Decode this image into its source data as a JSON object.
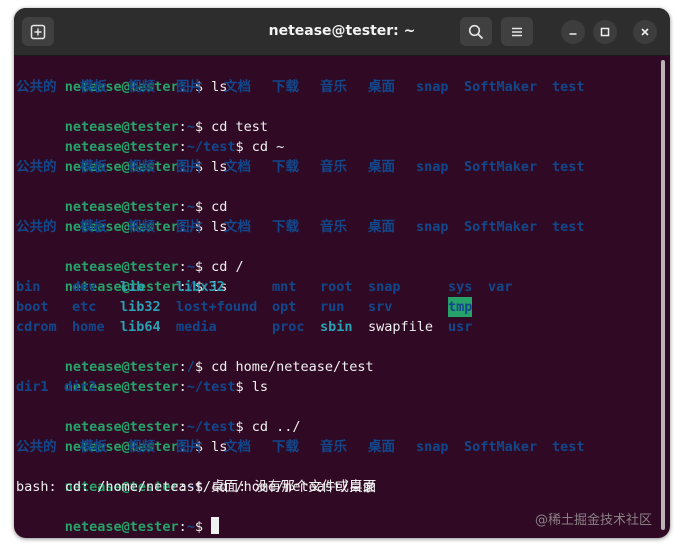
{
  "window": {
    "title": "netease@tester: ~"
  },
  "icons": {
    "new_tab": "new-tab-icon",
    "search": "search-icon",
    "menu": "hamburger-menu-icon",
    "minimize": "minimize-icon",
    "maximize": "maximize-icon",
    "close": "close-icon"
  },
  "colors": {
    "background": "#300a24",
    "user_host": "#26a269",
    "path_and_dirs": "#12488b",
    "text": "#f0f0f0",
    "symlink": "#2aa1b3",
    "sticky_dir_bg": "#26a269"
  },
  "terminal": {
    "user": "netease@tester",
    "home_dirs": [
      "公共的",
      "模板",
      "视频",
      "图片",
      "文档",
      "下载",
      "音乐",
      "桌面",
      "snap",
      "SoftMaker",
      "test"
    ],
    "root_dirs": {
      "row1": [
        "bin",
        "dev",
        "lib",
        "libx32",
        "mnt",
        "root",
        "snap",
        "sys",
        "var"
      ],
      "row2": [
        "boot",
        "etc",
        "lib32",
        "lost+found",
        "opt",
        "run",
        "srv",
        "tmp"
      ],
      "row3": [
        "cdrom",
        "home",
        "lib64",
        "media",
        "proc",
        "sbin",
        "swapfile",
        "usr"
      ]
    },
    "test_dirs": [
      "dir1",
      "dir2"
    ],
    "error_line": "bash: cd: /home/neteast/桌面: 没有那个文件或目录",
    "prompts": [
      {
        "path": "~",
        "cmd": "ls"
      },
      {
        "path": "~",
        "cmd": "cd test"
      },
      {
        "path": "~/test",
        "cmd": "cd ~"
      },
      {
        "path": "~",
        "cmd": "ls"
      },
      {
        "path": "~",
        "cmd": "cd"
      },
      {
        "path": "~",
        "cmd": "ls"
      },
      {
        "path": "~",
        "cmd": "cd /"
      },
      {
        "path": "/",
        "cmd": "ls"
      },
      {
        "path": "/",
        "cmd": "cd home/netease/test"
      },
      {
        "path": "~/test",
        "cmd": "ls"
      },
      {
        "path": "~/test",
        "cmd": "cd ../"
      },
      {
        "path": "~",
        "cmd": "ls"
      },
      {
        "path": "~",
        "cmd": "cd /home/neteast/桌面"
      },
      {
        "path": "~",
        "cmd": ""
      }
    ]
  },
  "watermark": "@稀土掘金技术社区"
}
